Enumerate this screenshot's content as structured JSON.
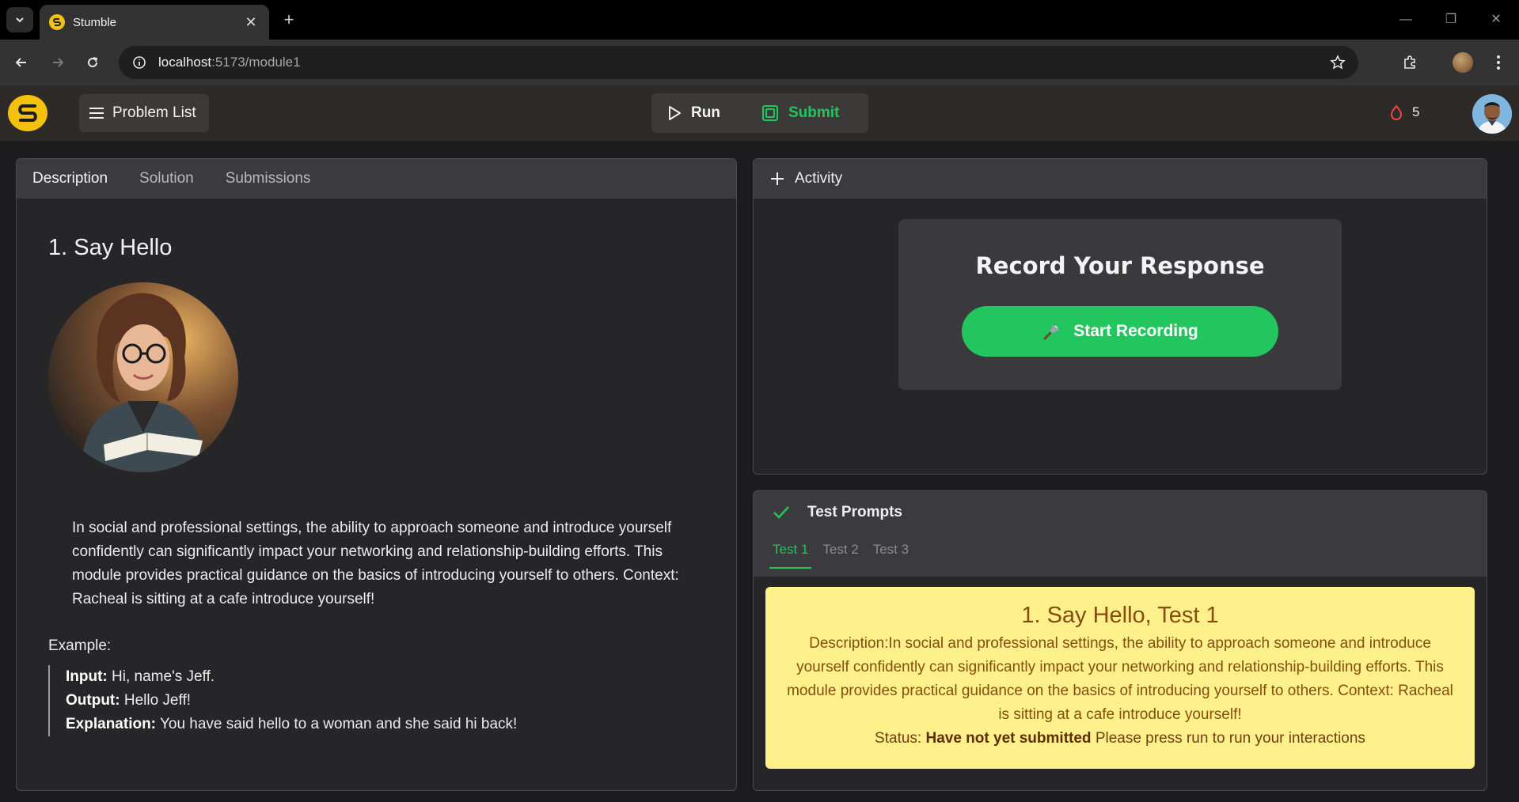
{
  "browser": {
    "tab_title": "Stumble",
    "url_host": "localhost",
    "url_path": ":5173/module1"
  },
  "header": {
    "problem_list_label": "Problem List",
    "run_label": "Run",
    "submit_label": "Submit",
    "streak_count": "5"
  },
  "description_panel": {
    "tabs": [
      "Description",
      "Solution",
      "Submissions"
    ],
    "title": "1. Say Hello",
    "body": "In social and professional settings, the ability to approach someone and introduce yourself confidently can significantly impact your networking and relationship-building efforts. This module provides practical guidance on the basics of introducing yourself to others. Context: Racheal is sitting at a cafe introduce yourself!",
    "example_label": "Example:",
    "example": {
      "input_label": "Input:",
      "input_value": "Hi, name's Jeff.",
      "output_label": "Output:",
      "output_value": "Hello Jeff!",
      "explanation_label": "Explanation:",
      "explanation_value": "You have said hello to a woman and she said hi back!"
    }
  },
  "activity_panel": {
    "title": "Activity",
    "record_title": "Record Your Response",
    "record_button": "Start Recording"
  },
  "tests_panel": {
    "title": "Test Prompts",
    "tabs": [
      "Test 1",
      "Test 2",
      "Test 3"
    ],
    "active_tab": "Test 1",
    "card_title": "1. Say Hello, Test 1",
    "card_description": "Description:In social and professional settings, the ability to approach someone and introduce yourself confidently can significantly impact your networking and relationship-building efforts. This module provides practical guidance on the basics of introducing yourself to others. Context: Racheal is sitting at a cafe introduce yourself!",
    "status_label": "Status:",
    "status_value": "Have not yet submitted",
    "status_hint": "Please press run to run your interactions"
  },
  "colors": {
    "accent_green": "#22c55e",
    "brand_yellow": "#f4c20d",
    "card_yellow": "#fef08a",
    "streak_red": "#ef4444"
  },
  "icons": {
    "logo": "stumble-logo",
    "problem_list": "hamburger-menu-icon",
    "run": "play-icon",
    "submit": "submit-icon",
    "streak": "flame-icon",
    "activity": "plus-icon",
    "record": "microphone-icon",
    "tests": "check-icon"
  }
}
